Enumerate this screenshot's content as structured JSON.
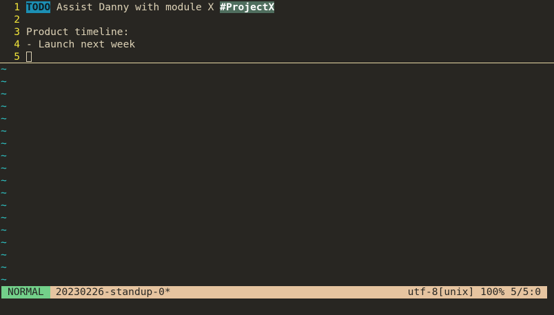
{
  "editor": {
    "lines": [
      {
        "num": "1",
        "todo": "TODO",
        "text": " Assist Danny with module X ",
        "tag": "#ProjectX"
      },
      {
        "num": "2",
        "text": ""
      },
      {
        "num": "3",
        "text": "Product timeline:"
      },
      {
        "num": "4",
        "text": "- Launch next week"
      },
      {
        "num": "5",
        "text": ""
      }
    ],
    "tilde": "~"
  },
  "statusbar": {
    "mode": "NORMAL",
    "filename": "20230226-standup-0*",
    "encoding": "utf-8[unix]",
    "percent": "100%",
    "position": "5/5:0"
  },
  "colors": {
    "background": "#282622",
    "line_number": "#f2e53a",
    "tilde": "#2ec7c9",
    "todo_bg": "#1c8fb4",
    "tag_bg": "#4f6e5e",
    "mode_bg": "#73d08a",
    "status_bg": "#e6c4a0"
  }
}
